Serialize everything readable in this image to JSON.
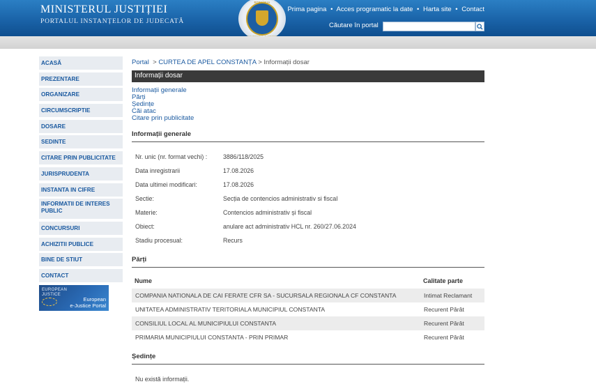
{
  "header": {
    "title": "MINISTERUL JUSTIȚIEI",
    "subtitle": "PORTALUL INSTANȚELOR DE JUDECATĂ",
    "crest_top": "ROMÂNIA",
    "crest_bottom": "MINISTERUL JUSTIȚIEI",
    "nav": [
      "Prima pagina",
      "Acces programatic la date",
      "Harta site",
      "Contact"
    ],
    "nav_sep": "•",
    "search_label": "Căutare în portal",
    "search_value": "",
    "search_icon": "magnifier-icon"
  },
  "sidebar": {
    "items": [
      {
        "label": "ACASĂ"
      },
      {
        "label": "PREZENTARE"
      },
      {
        "label": "ORGANIZARE"
      },
      {
        "label": "CIRCUMSCRIPTIE"
      },
      {
        "label": "DOSARE"
      },
      {
        "label": "SEDINTE"
      },
      {
        "label": "CITARE PRIN PUBLICITATE"
      },
      {
        "label": "JURISPRUDENTA"
      },
      {
        "label": "INSTANTA IN CIFRE"
      },
      {
        "label": "INFORMATII DE INTERES PUBLIC"
      },
      {
        "label": "CONCURSURI"
      },
      {
        "label": "ACHIZITII PUBLICE"
      },
      {
        "label": "BINE DE STIUT"
      },
      {
        "label": "CONTACT"
      }
    ],
    "banner": {
      "logo_line1": "EUROPEAN",
      "logo_line2": "JUSTICE",
      "text_line1": "European",
      "text_line2": "e-Justice Portal"
    }
  },
  "breadcrumb": {
    "portal": "Portal",
    "sep": ">",
    "court": "CURTEA DE APEL CONSTANȚA",
    "current": "Informații dosar"
  },
  "title": "Informații dosar",
  "sub_links": [
    "Informații generale",
    "Părți",
    "Ședințe",
    "Căi atac",
    "Citare prin publicitate"
  ],
  "general": {
    "heading": "Informații generale",
    "rows": [
      {
        "label": "Nr. unic (nr. format vechi) :",
        "value": "3886/118/2025"
      },
      {
        "label": "Data inregistrarii",
        "value": "17.08.2026"
      },
      {
        "label": "Data ultimei modificari:",
        "value": "17.08.2026"
      },
      {
        "label": "Sectie:",
        "value": "Secția de contencios administrativ si fiscal"
      },
      {
        "label": "Materie:",
        "value": "Contencios administrativ și fiscal"
      },
      {
        "label": "Obiect:",
        "value": "anulare act administrativ HCL nr. 260/27.06.2024"
      },
      {
        "label": "Stadiu procesual:",
        "value": "Recurs"
      }
    ]
  },
  "parti": {
    "heading": "Părți",
    "col_name": "Nume",
    "col_quality": "Calitate parte",
    "rows": [
      {
        "name": "COMPANIA NATIONALA DE CAI FERATE CFR SA - SUCURSALA REGIONALA CF CONSTANTA",
        "quality": "Intimat Reclamant"
      },
      {
        "name": "UNITATEA ADMINISTRATIV TERITORIALA MUNICIPIUL CONSTANTA",
        "quality": "Recurent Pârât"
      },
      {
        "name": "CONSILIUL LOCAL AL MUNICIPIULUI CONSTANTA",
        "quality": "Recurent Pârât"
      },
      {
        "name": "PRIMARIA MUNICIPIULUI CONSTANTA - PRIN PRIMAR",
        "quality": "Recurent Pârât"
      }
    ]
  },
  "sedinte": {
    "heading": "Ședințe",
    "empty": "Nu există informații."
  },
  "colors": {
    "header_blue": "#1a63a8",
    "link_blue": "#1b5aa0",
    "title_bar": "#3a3a3a",
    "sidebar_bg": "#e8ecf1"
  }
}
